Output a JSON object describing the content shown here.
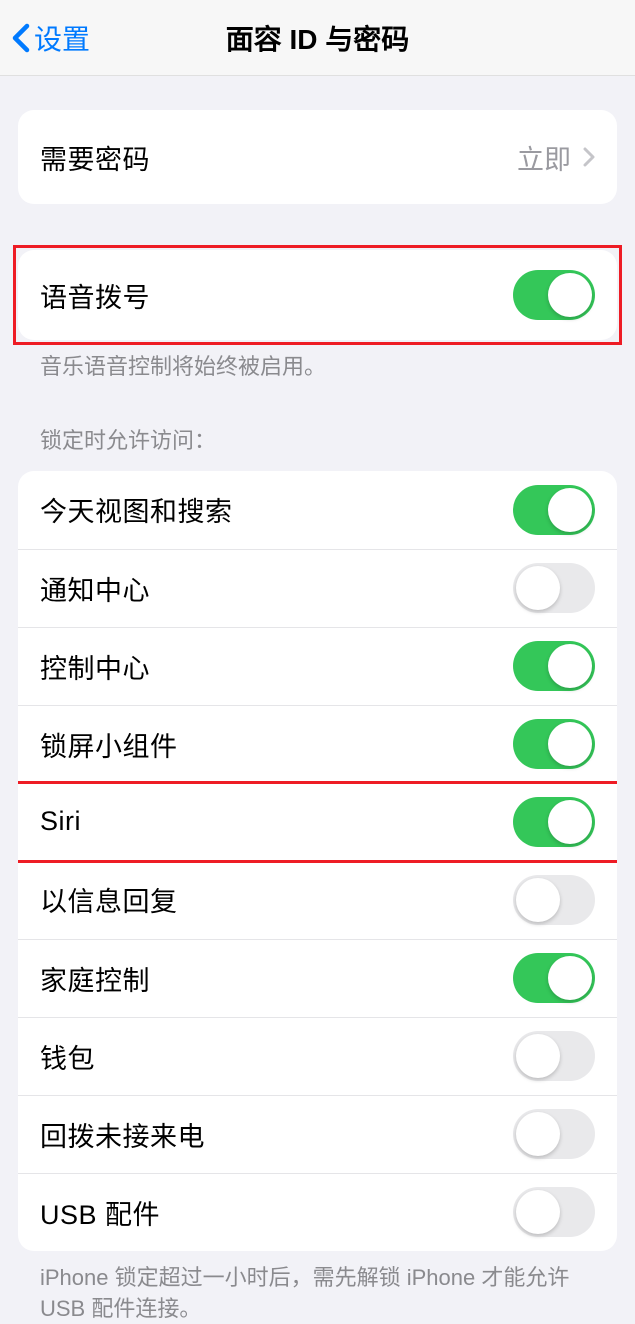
{
  "nav": {
    "back_label": "设置",
    "title": "面容 ID 与密码"
  },
  "passcode": {
    "label": "需要密码",
    "value": "立即"
  },
  "voice_dial": {
    "label": "语音拨号",
    "on": true,
    "footer": "音乐语音控制将始终被启用。"
  },
  "lock_access": {
    "header": "锁定时允许访问：",
    "items": [
      {
        "label": "今天视图和搜索",
        "on": true
      },
      {
        "label": "通知中心",
        "on": false
      },
      {
        "label": "控制中心",
        "on": true
      },
      {
        "label": "锁屏小组件",
        "on": true
      },
      {
        "label": "Siri",
        "on": true
      },
      {
        "label": "以信息回复",
        "on": false
      },
      {
        "label": "家庭控制",
        "on": true
      },
      {
        "label": "钱包",
        "on": false
      },
      {
        "label": "回拨未接来电",
        "on": false
      },
      {
        "label": "USB 配件",
        "on": false
      }
    ],
    "footer": "iPhone 锁定超过一小时后，需先解锁 iPhone 才能允许USB 配件连接。"
  }
}
